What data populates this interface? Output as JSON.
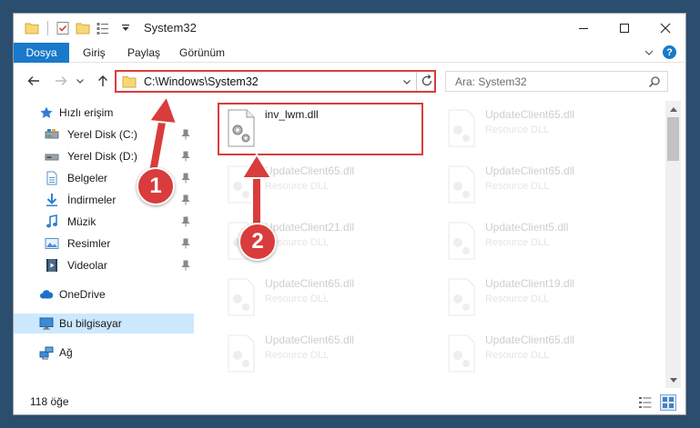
{
  "window": {
    "title": "System32",
    "controls": {
      "minimize": "—",
      "maximize": "☐",
      "close": "✕"
    }
  },
  "ribbon": {
    "tabs": [
      {
        "label": "Dosya",
        "active": true
      },
      {
        "label": "Giriş"
      },
      {
        "label": "Paylaş"
      },
      {
        "label": "Görünüm"
      }
    ],
    "help_label": "?"
  },
  "address": {
    "path": "C:\\Windows\\System32",
    "search_placeholder": "Ara: System32"
  },
  "navigation": [
    {
      "label": "Hızlı erişim",
      "icon": "star-icon",
      "pinned": false
    },
    {
      "label": "Yerel Disk (C:)",
      "icon": "drive-icon",
      "pinned": true
    },
    {
      "label": "Yerel Disk (D:)",
      "icon": "drive-icon",
      "pinned": true
    },
    {
      "label": "Belgeler",
      "icon": "documents-icon",
      "pinned": true
    },
    {
      "label": "İndirmeler",
      "icon": "download-icon",
      "pinned": true
    },
    {
      "label": "Müzik",
      "icon": "music-icon",
      "pinned": true
    },
    {
      "label": "Resimler",
      "icon": "pictures-icon",
      "pinned": true
    },
    {
      "label": "Videolar",
      "icon": "videos-icon",
      "pinned": true
    },
    {
      "label": "OneDrive",
      "icon": "cloud-icon"
    },
    {
      "label": "Bu bilgisayar",
      "icon": "computer-icon",
      "selected": true
    },
    {
      "label": "Ağ",
      "icon": "network-icon"
    }
  ],
  "files": [
    {
      "name": "inv_lwm.dll",
      "type": "",
      "highlighted": true
    },
    {
      "name": "UpdateClient65.dll",
      "type": "Resource DLL"
    },
    {
      "name": "UpdateClient65.dll",
      "type": "Resource DLL"
    },
    {
      "name": "UpdateClient65.dll",
      "type": "Resource DLL"
    },
    {
      "name": "UpdateClient21.dll",
      "type": "Resource DLL"
    },
    {
      "name": "UpdateClient5.dll",
      "type": "Resource DLL"
    },
    {
      "name": "UpdateClient65.dll",
      "type": "Resource DLL"
    },
    {
      "name": "UpdateClient19.dll",
      "type": "Resource DLL"
    },
    {
      "name": "UpdateClient65.dll",
      "type": "Resource DLL"
    },
    {
      "name": "UpdateClient65.dll",
      "type": "Resource DLL"
    }
  ],
  "status": {
    "item_count": "118 öğe"
  },
  "annotations": {
    "step1": "1",
    "step2": "2"
  },
  "colors": {
    "accent": "#1979ca",
    "highlight": "#d93c3c",
    "selection": "#cce8ff"
  }
}
